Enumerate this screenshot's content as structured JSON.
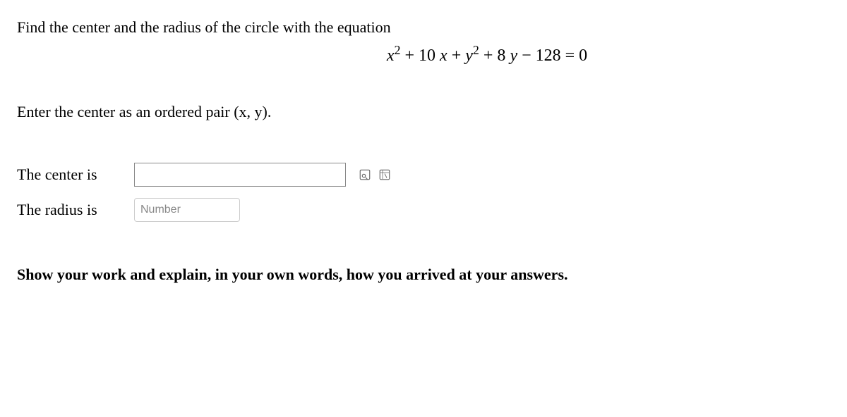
{
  "question": {
    "intro": "Find the center and the radius of the circle with the equation",
    "equation_parts": {
      "x": "x",
      "sq1": "2",
      "plus1": " + 10 ",
      "x2": "x",
      "plus2": "  + ",
      "y": "y",
      "sq2": "2",
      "plus3": " + 8 ",
      "y2": "y",
      "minus": "  −  128 = 0"
    },
    "instruction": "Enter the center as an ordered pair (x, y)."
  },
  "answers": {
    "center_label": "The center is",
    "center_value": "",
    "radius_label": "The radius is",
    "radius_value": "",
    "radius_placeholder": "Number"
  },
  "show_work": "Show your work and explain, in your own words, how you arrived at your answers.",
  "icons": {
    "eq_preview": "equation-preview-icon",
    "eq_help": "equation-help-icon"
  }
}
